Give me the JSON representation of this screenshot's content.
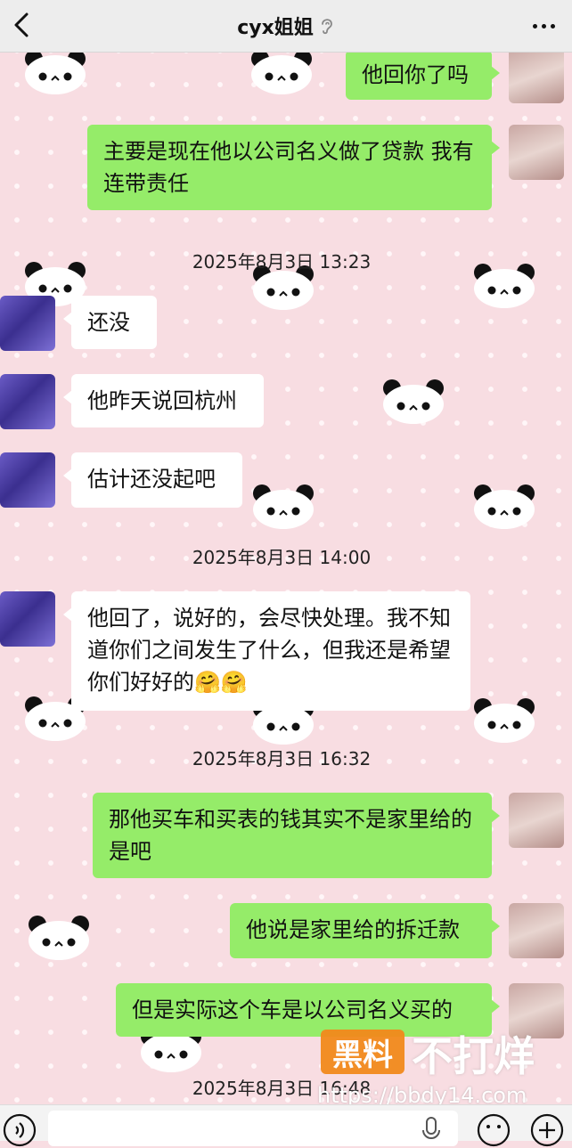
{
  "header": {
    "title": "cyx姐姐",
    "back_icon": "chevron-left-icon",
    "muted_icon": "ear-icon",
    "more_icon": "more-icon"
  },
  "messages": [
    {
      "side": "me",
      "text": "他回你了吗"
    },
    {
      "side": "me",
      "text": "主要是现在他以公司名义做了贷款 我有连带责任"
    },
    {
      "side": "other",
      "text": "还没"
    },
    {
      "side": "other",
      "text": "他昨天说回杭州"
    },
    {
      "side": "other",
      "text": "估计还没起吧"
    },
    {
      "side": "other",
      "text": "他回了，说好的，会尽快处理。我不知道你们之间发生了什么，但我还是希望你们好好的"
    },
    {
      "side": "me",
      "text": "那他买车和买表的钱其实不是家里给的是吧"
    },
    {
      "side": "me",
      "text": "他说是家里给的拆迁款"
    },
    {
      "side": "me",
      "text": "但是实际这个车是以公司名义买的"
    }
  ],
  "timestamps": [
    "2025年8月3日 13:23",
    "2025年8月3日 14:00",
    "2025年8月3日 16:32",
    "2025年8月3日 16:48"
  ],
  "emoji": [
    "🤗",
    "🤗"
  ],
  "watermark": {
    "box_text": "黑料",
    "text": "不打烊",
    "url": "https://bbdy14.com"
  },
  "input_bar": {
    "voice_icon": "voice-icon",
    "mic_icon": "microphone-icon",
    "emoji_icon": "emoji-icon",
    "plus_icon": "plus-icon"
  },
  "colors": {
    "my_bubble": "#95ec69",
    "other_bubble": "#ffffff",
    "background": "#f8dde2",
    "watermark_orange": "#f28a1c"
  }
}
